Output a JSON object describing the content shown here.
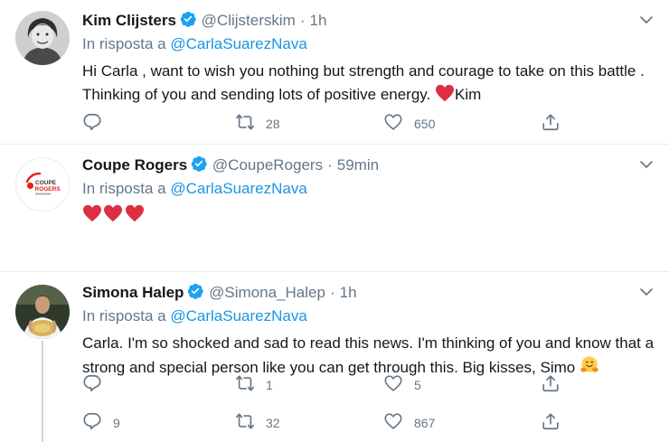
{
  "tweets": [
    {
      "name": "Kim Clijsters",
      "handle": "@Clijsterskim",
      "separator": "·",
      "time": "1h",
      "reply_prefix": "In risposta a",
      "reply_to": "@CarlaSuarezNava",
      "text": "Hi Carla , want to wish you nothing but strength and courage to take on this battle . Thinking of you and sending lots of positive energy.",
      "text_suffix": "Kim",
      "replies": "",
      "retweets": "28",
      "likes": "650"
    },
    {
      "name": "Coupe Rogers",
      "handle": "@CoupeRogers",
      "separator": "·",
      "time": "59min",
      "reply_prefix": "In risposta a",
      "reply_to": "@CarlaSuarezNava",
      "avatar_logo_text": "COUPE ROGERS",
      "replies": "",
      "retweets": "1",
      "likes": "5"
    },
    {
      "name": "Simona Halep",
      "handle": "@Simona_Halep",
      "separator": "·",
      "time": "1h",
      "reply_prefix": "In risposta a",
      "reply_to": "@CarlaSuarezNava",
      "text": "Carla. I'm so shocked and sad to read this news. I'm thinking of you and know that a strong and special person like you can get through this. Big kisses, Simo",
      "replies": "9",
      "retweets": "32",
      "likes": "867"
    }
  ],
  "colors": {
    "link": "#1b95e0",
    "muted": "#657786",
    "verified": "#1da1f2",
    "heart": "#e0245e",
    "divider": "#e6ecf0"
  }
}
